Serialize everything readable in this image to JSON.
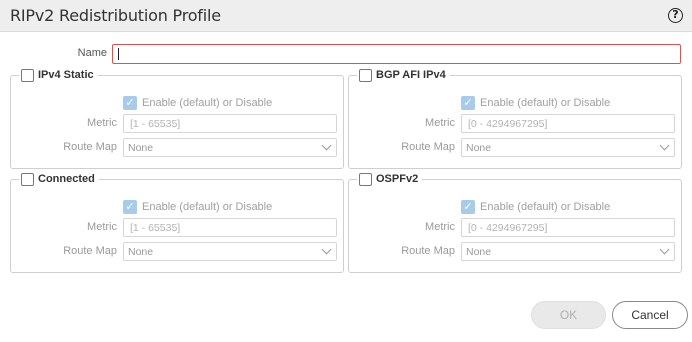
{
  "dialog": {
    "title": "RIPv2 Redistribution Profile",
    "help_icon": "question-circle-icon"
  },
  "name_field": {
    "label": "Name",
    "value": ""
  },
  "groups": [
    {
      "label": "IPv4 Static",
      "checked": false,
      "enable_label": "Enable (default) or Disable",
      "enable_checked": true,
      "metric_label": "Metric",
      "metric_placeholder": "[1 - 65535]",
      "route_map_label": "Route Map",
      "route_map_value": "None"
    },
    {
      "label": "BGP AFI IPv4",
      "checked": false,
      "enable_label": "Enable (default) or Disable",
      "enable_checked": true,
      "metric_label": "Metric",
      "metric_placeholder": "[0 - 4294967295]",
      "route_map_label": "Route Map",
      "route_map_value": "None"
    },
    {
      "label": "Connected",
      "checked": false,
      "enable_label": "Enable (default) or Disable",
      "enable_checked": true,
      "metric_label": "Metric",
      "metric_placeholder": "[1 - 65535]",
      "route_map_label": "Route Map",
      "route_map_value": "None"
    },
    {
      "label": "OSPFv2",
      "checked": false,
      "enable_label": "Enable (default) or Disable",
      "enable_checked": true,
      "metric_label": "Metric",
      "metric_placeholder": "[0 - 4294967295]",
      "route_map_label": "Route Map",
      "route_map_value": "None"
    }
  ],
  "buttons": {
    "ok": "OK",
    "cancel": "Cancel"
  }
}
